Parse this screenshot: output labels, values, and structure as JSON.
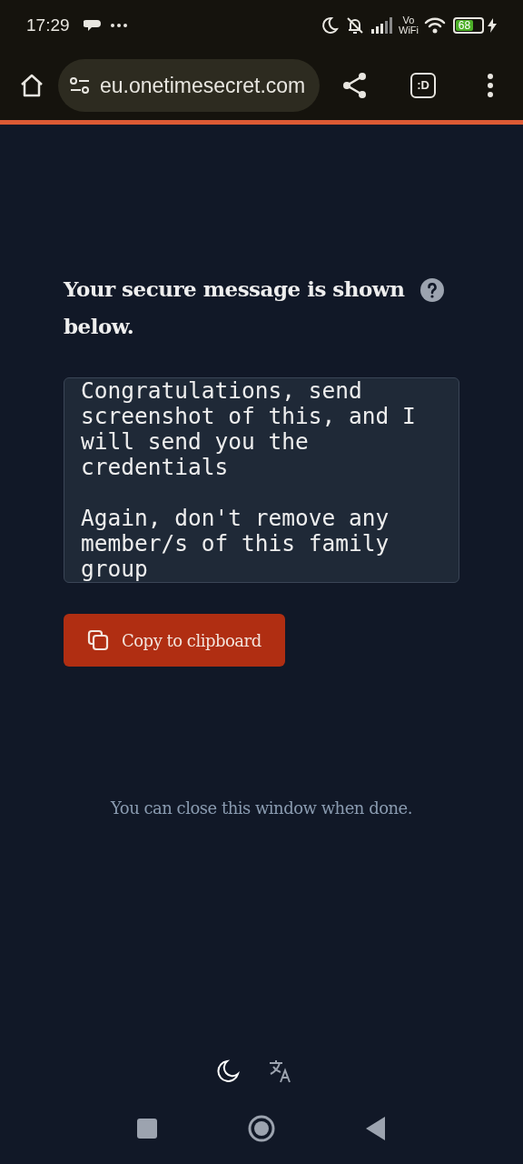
{
  "status_bar": {
    "time": "17:29",
    "network_label": "Vo\nWiFi",
    "battery": "68"
  },
  "browser_bar": {
    "url": "eu.onetimesecret.com",
    "tab_count": ":D"
  },
  "heading": "Your secure message is shown below.",
  "message": "Congratulations, send screenshot of this, and I will send you the credentials\n\nAgain, don't remove any member/s of this family group",
  "copy_button": "Copy to clipboard",
  "note": "You can close this window when done."
}
